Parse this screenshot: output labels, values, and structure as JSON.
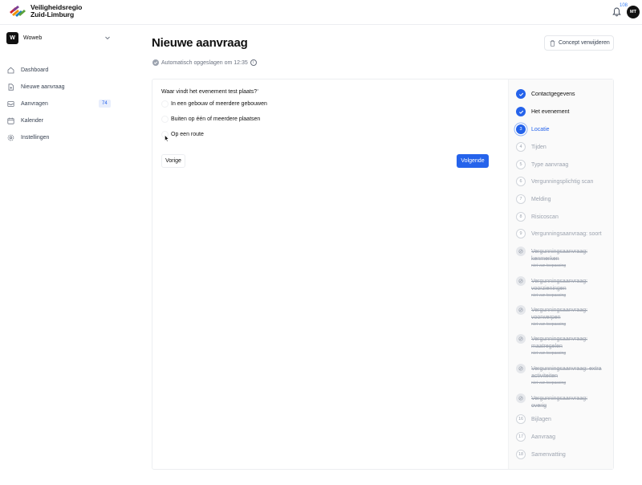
{
  "brand": {
    "line1": "Veiligheidsregio",
    "line2": "Zuid-Limburg"
  },
  "header": {
    "notifications_count": "108",
    "avatar_initials": "MT"
  },
  "org": {
    "badge": "W",
    "name": "Woweb"
  },
  "sidebar": {
    "items": [
      {
        "label": "Dashboard",
        "icon": "home-icon"
      },
      {
        "label": "Nieuwe aanvraag",
        "icon": "file-plus-icon"
      },
      {
        "label": "Aanvragen",
        "icon": "inbox-icon",
        "badge": "74"
      },
      {
        "label": "Kalender",
        "icon": "calendar-icon"
      },
      {
        "label": "Instellingen",
        "icon": "gear-icon"
      }
    ]
  },
  "main": {
    "title": "Nieuwe aanvraag",
    "delete_label": "Concept verwijderen",
    "autosave_text": "Automatisch opgeslagen om 12:35",
    "question": "Waar vindt het evenement test plaats?",
    "question_mark": "*",
    "options": [
      "In een gebouw of meerdere gebouwen",
      "Buiten op één of meerdere plaatsen",
      "Op een route"
    ],
    "prev_label": "Vorige",
    "next_label": "Volgende"
  },
  "steps": [
    {
      "num": "1",
      "label": "Contactgegevens",
      "state": "done"
    },
    {
      "num": "2",
      "label": "Het evenement",
      "state": "done"
    },
    {
      "num": "3",
      "label": "Locatie",
      "state": "current"
    },
    {
      "num": "4",
      "label": "Tijden",
      "state": "todo"
    },
    {
      "num": "5",
      "label": "Type aanvraag",
      "state": "todo"
    },
    {
      "num": "6",
      "label": "Vergunningsplichtig scan",
      "state": "todo"
    },
    {
      "num": "7",
      "label": "Melding",
      "state": "todo"
    },
    {
      "num": "8",
      "label": "Risicoscan",
      "state": "todo"
    },
    {
      "num": "9",
      "label": "Vergunningsaanvraag: soort",
      "state": "todo"
    },
    {
      "num": "",
      "label": "Vergunningsaanvraag: kenmerken",
      "state": "na",
      "sub": "niet van toepassing"
    },
    {
      "num": "",
      "label": "Vergunningsaanvraag: voorzieningen",
      "state": "na",
      "sub": "niet van toepassing"
    },
    {
      "num": "",
      "label": "Vergunningsaanvraag: voorwerpen",
      "state": "na",
      "sub": "niet van toepassing"
    },
    {
      "num": "",
      "label": "Vergunningsaanvraag: maatregelen",
      "state": "na",
      "sub": "niet van toepassing"
    },
    {
      "num": "",
      "label": "Vergunningsaanvraag: extra activiteiten",
      "state": "na",
      "sub": "niet van toepassing"
    },
    {
      "num": "",
      "label": "Vergunningsaanvraag: overig",
      "state": "na"
    },
    {
      "num": "16",
      "label": "Bijlagen",
      "state": "todo"
    },
    {
      "num": "17",
      "label": "Aanvraag",
      "state": "todo"
    },
    {
      "num": "18",
      "label": "Samenvatting",
      "state": "todo"
    }
  ],
  "colors": {
    "accent": "#2563eb",
    "muted": "#9ca3af"
  }
}
